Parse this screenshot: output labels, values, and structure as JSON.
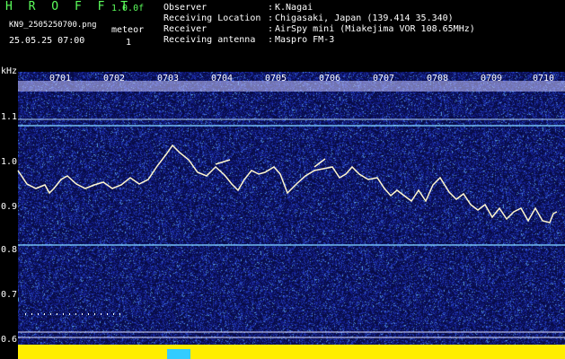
{
  "header": {
    "brand": "H R O F F T",
    "version": "1.0.0f",
    "filename": "KN9_2505250700.png",
    "meteor_label": "meteor",
    "meteor_count": "1",
    "datetime": "25.05.25 07:00"
  },
  "info": [
    {
      "label": "Observer",
      "value": "K.Nagai"
    },
    {
      "label": "Receiving Location",
      "value": "Chigasaki, Japan (139.414 35.340)"
    },
    {
      "label": "Receiver",
      "value": "AirSpy mini (Miakejima VOR 108.65MHz)"
    },
    {
      "label": "Receiving antenna",
      "value": "Maspro FM-3"
    }
  ],
  "axis": {
    "y_unit": "kHz",
    "y_ticks": [
      "1.1",
      "1.0",
      "0.9",
      "0.8",
      "0.7",
      "0.6"
    ],
    "x_ticks": [
      "0701",
      "0702",
      "0703",
      "0704",
      "0705",
      "0706",
      "0707",
      "0708",
      "0709",
      "0710"
    ]
  },
  "colors": {
    "background": "#000000",
    "noise": "#1a1f8c",
    "trace": "#ffffff",
    "meter": "#ffee00",
    "meter_highlight": "#33ccff"
  }
}
